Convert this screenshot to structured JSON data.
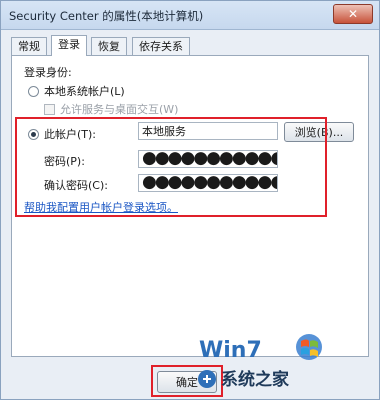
{
  "window": {
    "title": "Security Center 的属性(本地计算机)",
    "close_glyph": "✕"
  },
  "tabs": [
    {
      "label": "常规",
      "active": false
    },
    {
      "label": "登录",
      "active": true
    },
    {
      "label": "恢复",
      "active": false
    },
    {
      "label": "依存关系",
      "active": false
    }
  ],
  "logon": {
    "section_label": "登录身份:",
    "local_system": {
      "label": "本地系统帐户(L)",
      "selected": false
    },
    "interact": {
      "label": "允许服务与桌面交互(W)",
      "checked": false,
      "enabled": false
    },
    "this_account": {
      "label": "此帐户(T):",
      "selected": true,
      "value": "本地服务"
    },
    "browse_label": "浏览(B)...",
    "password": {
      "label": "密码(P):",
      "masked": "●●●●●●●●●●●●●●●●●●"
    },
    "confirm": {
      "label": "确认密码(C):",
      "masked": "●●●●●●●●●●●●●●●●●●"
    },
    "help_link": "帮助我配置用户帐户登录选项。"
  },
  "footer": {
    "ok_label": "确定"
  },
  "watermark": {
    "brand": "Win7",
    "site": "系统之家"
  },
  "colors": {
    "highlight": "#e0202a",
    "link": "#1a56c4"
  }
}
